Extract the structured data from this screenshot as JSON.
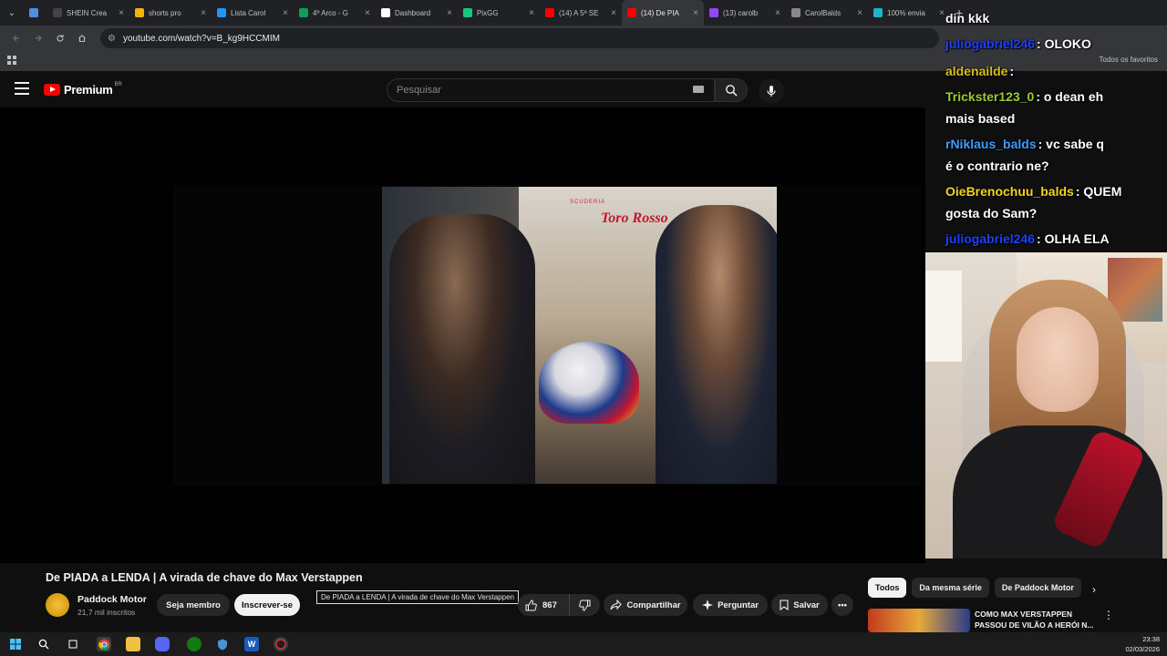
{
  "browser": {
    "tabs": [
      {
        "label": "",
        "color": "#4f8de0"
      },
      {
        "label": "SHEIN Crea",
        "color": "#444444"
      },
      {
        "label": "shorts pro",
        "color": "#f4b400"
      },
      {
        "label": "Lista Carol",
        "color": "#2196f3"
      },
      {
        "label": "4º Arco - G",
        "color": "#0f9d58"
      },
      {
        "label": "Dashboard",
        "color": "#ffffff"
      },
      {
        "label": "PixGG",
        "color": "#16c784"
      },
      {
        "label": "(14) A 5ª SE",
        "color": "#ff0000"
      },
      {
        "label": "(14) De PIA",
        "color": "#ff0000"
      },
      {
        "label": "(13) carolb",
        "color": "#9146ff"
      },
      {
        "label": "CarolBalds",
        "color": "#888888"
      },
      {
        "label": "100% envia",
        "color": "#18b7c5"
      }
    ],
    "active_tab_index": 8,
    "url": "youtube.com/watch?v=B_kg9HCCMIM",
    "bookmarks_all_label": "Todos os favoritos"
  },
  "youtube": {
    "logo_text": "Premium",
    "country_code": "BR",
    "search_placeholder": "Pesquisar",
    "video_title": "De PIADA a LENDA | A virada de chave do Max Verstappen",
    "tooltip": "De PIADA a LENDA | A virada de chave do Max Verstappen",
    "channel": {
      "name": "Paddock Motor",
      "subscribers": "21,7 mil inscritos"
    },
    "buttons": {
      "member": "Seja membro",
      "subscribe": "Inscrever-se",
      "likes": "867",
      "share": "Compartilhar",
      "ask": "Perguntar",
      "save": "Salvar"
    },
    "chips": [
      "Todos",
      "Da mesma série",
      "De Paddock Motor"
    ],
    "recommendation": {
      "title": "COMO MAX VERSTAPPEN PASSOU DE VILÃO A HERÓI N..."
    },
    "video_overlay_text": {
      "brand": "Toro Rosso",
      "brand_sub": "SCUDERIA"
    }
  },
  "chat": {
    "messages": [
      {
        "user": "din kkk",
        "message": "",
        "user_color": "#ffffff"
      },
      {
        "user": "juliogabriel246",
        "message": ": OLOKO",
        "user_color": "#1e3fff"
      },
      {
        "user": "aldenailde",
        "message": ":",
        "user_color": "#d4c21a"
      },
      {
        "user": "Trickster123_0",
        "message": ": o dean eh",
        "user_color": "#9acd32"
      },
      {
        "user": "mais based",
        "message": "",
        "user_color": "#ffffff"
      },
      {
        "user": "rNiklaus_balds",
        "message": ": vc sabe q",
        "user_color": "#3d9cff"
      },
      {
        "user": "é o contrario ne?",
        "message": "",
        "user_color": "#ffffff"
      },
      {
        "user": "OieBrenochuu_balds",
        "message": ": QUEM",
        "user_color": "#f2d61b"
      },
      {
        "user": "gosta do Sam?",
        "message": "",
        "user_color": "#ffffff"
      },
      {
        "user": "juliogabriel246",
        "message": ": OLHA ELA",
        "user_color": "#1e3fff"
      }
    ]
  },
  "taskbar": {
    "time": "23:38",
    "date": "02/03/2026"
  }
}
